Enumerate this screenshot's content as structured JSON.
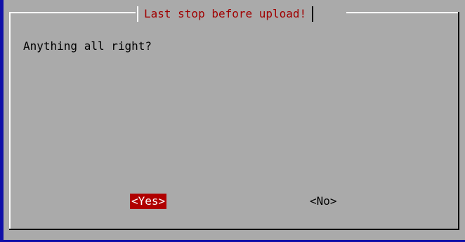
{
  "dialog": {
    "title": "Last stop before upload!",
    "message": "Anything all right?",
    "buttons": {
      "yes_label": "<Yes>",
      "no_label": "<No>",
      "selected": "yes"
    }
  },
  "colors": {
    "background": "#1010a8",
    "dialog": "#aaaaaa",
    "title_text": "#a00000",
    "selected_button": "#b00000"
  }
}
